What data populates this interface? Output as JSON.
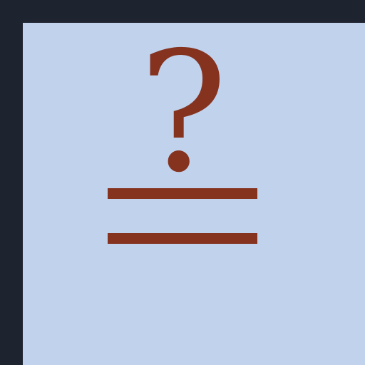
{
  "colors": {
    "frame": "#1e2330",
    "background": "#c1d2ec",
    "glyph": "#85331f"
  },
  "symbol": {
    "icon": "question-mark-over-double-bar",
    "mark": "?"
  }
}
